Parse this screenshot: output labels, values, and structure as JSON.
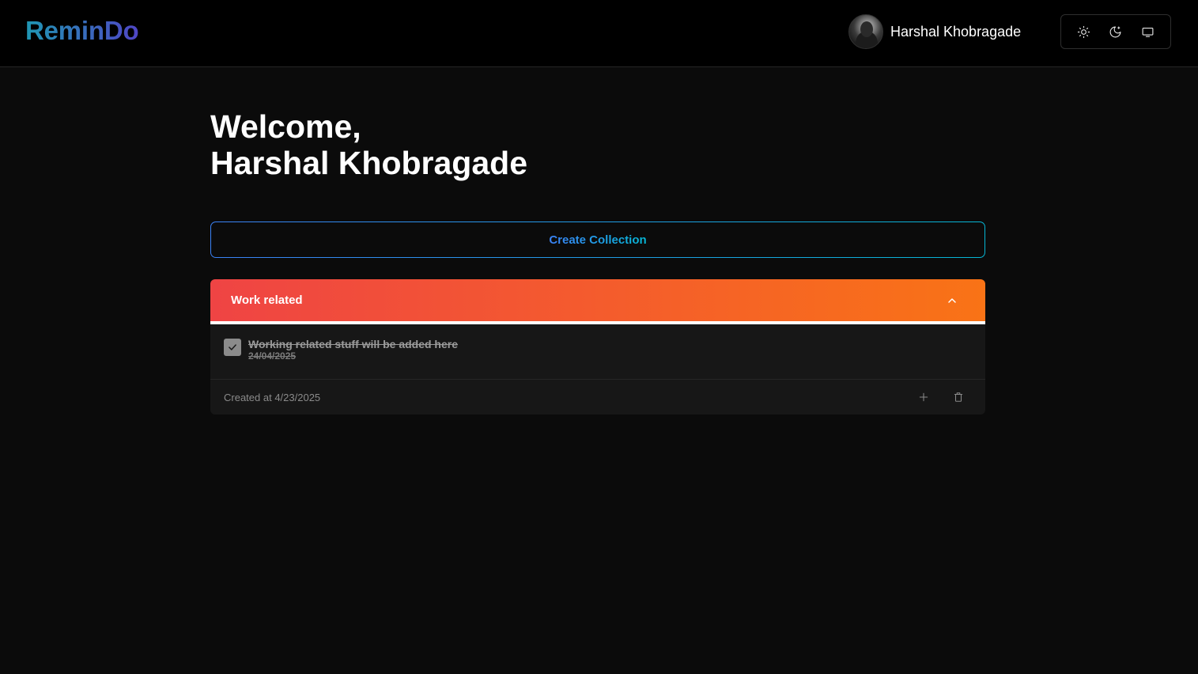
{
  "app": {
    "name": "ReminDo"
  },
  "user": {
    "name": "Harshal Khobragade"
  },
  "theme": {
    "options": [
      {
        "name": "light",
        "icon": "sun-icon"
      },
      {
        "name": "dark",
        "icon": "moon-icon"
      },
      {
        "name": "system",
        "icon": "monitor-icon"
      }
    ]
  },
  "welcome": {
    "line1": "Welcome,",
    "line2": "Harshal Khobragade"
  },
  "actions": {
    "create_collection": "Create Collection"
  },
  "collection": {
    "title": "Work related",
    "colors": {
      "from": "#ef4444",
      "to": "#f97316"
    },
    "tasks": [
      {
        "title": "Working related stuff will be added here",
        "date": "24/04/2025",
        "done": true
      }
    ],
    "created": "Created at 4/23/2025"
  },
  "colors": {
    "brand_from": "#1f97b3",
    "brand_to": "#4f46c5",
    "button_from": "#3b82f6",
    "button_to": "#06b6d4"
  }
}
